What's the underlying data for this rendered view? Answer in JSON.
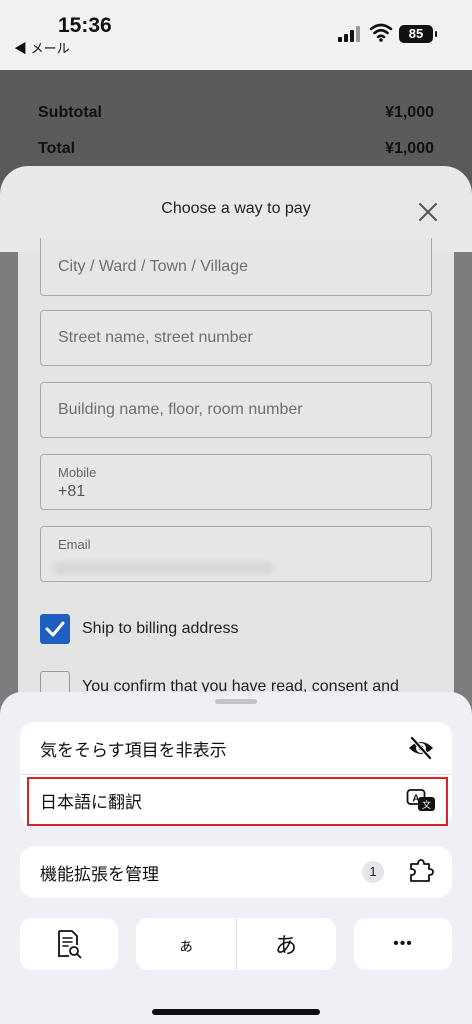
{
  "status_bar": {
    "time": "15:36",
    "back_app": "◀ メール",
    "battery": "85"
  },
  "summary": {
    "subtotal_label": "Subtotal",
    "subtotal_value": "¥1,000",
    "total_label": "Total",
    "total_value": "¥1,000"
  },
  "pay_sheet": {
    "title": "Choose a way to pay",
    "fields": {
      "city_placeholder": "City / Ward / Town / Village",
      "street_placeholder": "Street name, street number",
      "building_placeholder": "Building name, floor, room number",
      "mobile_label": "Mobile",
      "mobile_value": "+81",
      "email_label": "Email"
    },
    "ship_to_billing": "Ship to billing address",
    "confirm_text": "You confirm that you have read, consent and"
  },
  "menu": {
    "hide_distracting": "気をそらす項目を非表示",
    "translate": "日本語に翻訳",
    "manage_extensions": "機能拡張を管理",
    "extensions_count": "1",
    "text_small": "ぁ",
    "text_large": "あ",
    "more": "•••"
  },
  "colors": {
    "highlight": "#d92128",
    "checkbox": "#1f5fbf"
  }
}
